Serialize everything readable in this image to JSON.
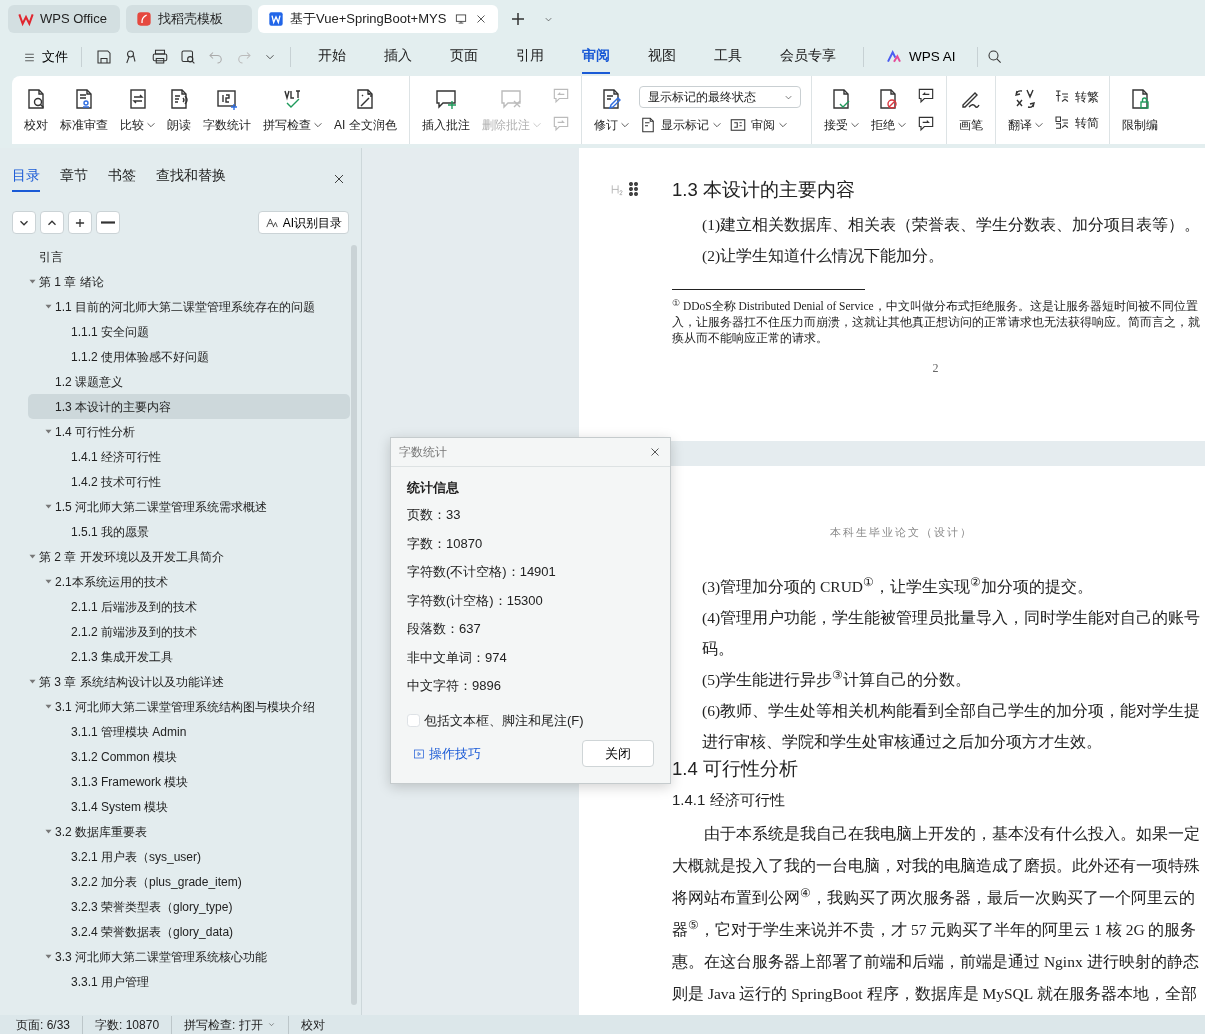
{
  "app_tabs": [
    {
      "label": "WPS Office",
      "selected": false
    },
    {
      "label": "找稻壳模板",
      "selected": false
    },
    {
      "label": "基于Vue+SpringBoot+MYS",
      "selected": true
    }
  ],
  "menu": {
    "file": "文件",
    "tabs": [
      {
        "label": "开始",
        "selected": false
      },
      {
        "label": "插入",
        "selected": false
      },
      {
        "label": "页面",
        "selected": false
      },
      {
        "label": "引用",
        "selected": false
      },
      {
        "label": "审阅",
        "selected": true
      },
      {
        "label": "视图",
        "selected": false
      },
      {
        "label": "工具",
        "selected": false
      },
      {
        "label": "会员专享",
        "selected": false
      }
    ],
    "ai": "WPS AI"
  },
  "ribbon": {
    "groups": [
      {
        "items": [
          {
            "kind": "large",
            "label": "校对",
            "dropdown": false,
            "disabled": false
          },
          {
            "kind": "large",
            "label": "标准审查",
            "dropdown": false,
            "disabled": false
          },
          {
            "kind": "large",
            "label": "比较",
            "dropdown": true,
            "disabled": false
          },
          {
            "kind": "large",
            "label": "朗读",
            "dropdown": false,
            "disabled": false
          },
          {
            "kind": "large",
            "label": "字数统计",
            "dropdown": false,
            "disabled": false
          },
          {
            "kind": "large",
            "label": "拼写检查",
            "dropdown": true,
            "disabled": false
          },
          {
            "kind": "large",
            "label": "AI 全文润色",
            "dropdown": false,
            "disabled": false
          }
        ]
      },
      {
        "items": [
          {
            "kind": "large",
            "label": "插入批注",
            "dropdown": false,
            "disabled": false
          },
          {
            "kind": "large",
            "label": "删除批注",
            "dropdown": true,
            "disabled": true
          },
          {
            "kind": "stack",
            "rows": [
              [
                {
                  "kind": "icon",
                  "disabled": true
                }
              ],
              [
                {
                  "kind": "icon",
                  "disabled": true
                }
              ]
            ]
          }
        ]
      },
      {
        "items": [
          {
            "kind": "large",
            "label": "修订",
            "dropdown": true,
            "disabled": false
          },
          {
            "kind": "stack",
            "rows": [
              [
                {
                  "kind": "select",
                  "value": "显示标记的最终状态"
                }
              ],
              [
                {
                  "kind": "small",
                  "label": "显示标记",
                  "dropdown": true
                },
                {
                  "kind": "small",
                  "label": "审阅",
                  "dropdown": true
                }
              ]
            ]
          }
        ]
      },
      {
        "items": [
          {
            "kind": "large",
            "label": "接受",
            "dropdown": true,
            "disabled": false
          },
          {
            "kind": "large",
            "label": "拒绝",
            "dropdown": true,
            "disabled": false
          },
          {
            "kind": "stack",
            "rows": [
              [
                {
                  "kind": "icon",
                  "disabled": false
                }
              ],
              [
                {
                  "kind": "icon",
                  "disabled": false
                }
              ]
            ]
          }
        ]
      },
      {
        "items": [
          {
            "kind": "large",
            "label": "画笔",
            "dropdown": false,
            "disabled": false
          }
        ]
      },
      {
        "items": [
          {
            "kind": "large",
            "label": "翻译",
            "dropdown": true,
            "disabled": false
          },
          {
            "kind": "stack",
            "rows": [
              [
                {
                  "kind": "small",
                  "label": "转繁",
                  "dropdown": false
                }
              ],
              [
                {
                  "kind": "small",
                  "label": "转简",
                  "dropdown": false
                }
              ]
            ]
          }
        ]
      },
      {
        "items": [
          {
            "kind": "large",
            "label": "限制编",
            "dropdown": false,
            "disabled": false
          }
        ]
      }
    ]
  },
  "sidebar": {
    "tabs": [
      {
        "label": "目录",
        "selected": true
      },
      {
        "label": "章节",
        "selected": false
      },
      {
        "label": "书签",
        "selected": false
      },
      {
        "label": "查找和替换",
        "selected": false
      }
    ],
    "ai_button": "AI识别目录",
    "outline": [
      {
        "label": "引言",
        "selected": false
      },
      {
        "label": "第 1 章  绪论",
        "selected": false,
        "expanded": true,
        "children": [
          {
            "label": "1.1  目前的河北师大第二课堂管理系统存在的问题",
            "selected": false,
            "expanded": true,
            "children": [
              {
                "label": "1.1.1  安全问题",
                "selected": false
              },
              {
                "label": "1.1.2  使用体验感不好问题",
                "selected": false
              }
            ]
          },
          {
            "label": "1.2  课题意义",
            "selected": false
          },
          {
            "label": "1.3  本设计的主要内容",
            "selected": true
          },
          {
            "label": "1.4  可行性分析",
            "selected": false,
            "expanded": true,
            "children": [
              {
                "label": "1.4.1  经济可行性",
                "selected": false
              },
              {
                "label": "1.4.2  技术可行性",
                "selected": false
              }
            ]
          },
          {
            "label": "1.5  河北师大第二课堂管理系统需求概述",
            "selected": false,
            "expanded": true,
            "children": [
              {
                "label": "1.5.1  我的愿景",
                "selected": false
              }
            ]
          }
        ]
      },
      {
        "label": "第 2 章    开发环境以及开发工具简介",
        "selected": false,
        "expanded": true,
        "children": [
          {
            "label": "2.1本系统运用的技术",
            "selected": false,
            "expanded": true,
            "children": [
              {
                "label": "2.1.1  后端涉及到的技术",
                "selected": false
              },
              {
                "label": "2.1.2  前端涉及到的技术",
                "selected": false
              },
              {
                "label": "2.1.3  集成开发工具",
                "selected": false
              }
            ]
          }
        ]
      },
      {
        "label": "第 3 章    系统结构设计以及功能详述",
        "selected": false,
        "expanded": true,
        "children": [
          {
            "label": "3.1  河北师大第二课堂管理系统结构图与模块介绍",
            "selected": false,
            "expanded": true,
            "children": [
              {
                "label": "3.1.1  管理模块 Admin",
                "selected": false
              },
              {
                "label": "3.1.2 Common 模块",
                "selected": false
              },
              {
                "label": "3.1.3 Framework 模块",
                "selected": false
              },
              {
                "label": "3.1.4 System 模块",
                "selected": false
              }
            ]
          },
          {
            "label": "3.2  数据库重要表",
            "selected": false,
            "expanded": true,
            "children": [
              {
                "label": "3.2.1  用户表（sys_user)",
                "selected": false
              },
              {
                "label": "3.2.2  加分表（plus_grade_item)",
                "selected": false
              },
              {
                "label": "3.2.3  荣誉类型表（glory_type)",
                "selected": false
              },
              {
                "label": "3.2.4  荣誉数据表（glory_data)",
                "selected": false
              }
            ]
          },
          {
            "label": "3.3  河北师大第二课堂管理系统核心功能",
            "selected": false,
            "expanded": true,
            "children": [
              {
                "label": "3.3.1  用户管理",
                "selected": false
              }
            ]
          }
        ]
      }
    ]
  },
  "document": {
    "page1": {
      "blocks": [
        {
          "kind": "heading2",
          "text": "1.3  本设计的主要内容"
        },
        {
          "kind": "item",
          "text": "(1)建立相关数据库、相关表（荣誉表、学生分数表、加分项目表等）。"
        },
        {
          "kind": "item",
          "text": "(2)让学生知道什么情况下能加分。"
        }
      ],
      "footnote": [
        "$^{①}$ DDoS全称 Distributed Denial of Service，中文叫做分布式拒绝服务。这是让服务器短时间被不同位置",
        "入，让服务器扛不住压力而崩溃，这就让其他真正想访问的正常请求也无法获得响应。简而言之，就",
        "痪从而不能响应正常的请求。"
      ],
      "page_number": "2"
    },
    "page2": {
      "header": "本科生毕业论文（设计）",
      "blocks": [
        {
          "kind": "item",
          "text": "(3)管理加分项的 CRUD$^{①}$，让学生实现$^{②}$加分项的提交。"
        },
        {
          "kind": "item",
          "text": "(4)管理用户功能，学生能被管理员批量导入，同时学生能对自己的账号"
        },
        {
          "kind": "item",
          "text": "码。"
        },
        {
          "kind": "item",
          "text": "(5)学生能进行异步$^{③}$计算自己的分数。"
        },
        {
          "kind": "item",
          "text": "(6)教师、学生处等相关机构能看到全部自己学生的加分项，能对学生提"
        },
        {
          "kind": "item",
          "text": "进行审核、学院和学生处审核通过之后加分项方才生效。"
        },
        {
          "kind": "heading2",
          "text": "1.4  可行性分析"
        },
        {
          "kind": "heading3",
          "text": "1.4.1  经济可行性"
        },
        {
          "kind": "first",
          "text": "由于本系统是我自己在我电脑上开发的，基本没有什么投入。如果一定"
        },
        {
          "kind": "line",
          "text": "大概就是投入了我的一台电脑，对我的电脑造成了磨损。此外还有一项特殊"
        },
        {
          "kind": "line",
          "text": "将网站布置到公网$^{④}$，我购买了两次服务器，最后一次购买了一个阿里云的"
        },
        {
          "kind": "line",
          "text": "器$^{⑤}$，它对于学生来说并不贵，才 57 元购买了半年的阿里云 1 核 2G 的服务"
        },
        {
          "kind": "line",
          "text": "惠。在这台服务器上部署了前端和后端，前端是通过 Nginx 进行映射的静态"
        },
        {
          "kind": "line",
          "text": "则是 Java 运行的 SpringBoot 程序，数据库是 MySQL 就在服务器本地，全部"
        }
      ]
    }
  },
  "dialog": {
    "title": "字数统计",
    "section": "统计信息",
    "stats": [
      {
        "label": "页数：",
        "value": "33"
      },
      {
        "label": "字数：",
        "value": "10870"
      },
      {
        "label": "字符数(不计空格)：",
        "value": "14901"
      },
      {
        "label": "字符数(计空格)：",
        "value": "15300"
      },
      {
        "label": "段落数：",
        "value": "637"
      },
      {
        "label": "非中文单词：",
        "value": "974"
      },
      {
        "label": "中文字符：",
        "value": "9896"
      }
    ],
    "checkbox": {
      "label": "包括文本框、脚注和尾注(F)",
      "checked": false
    },
    "tips_link": "操作技巧",
    "close_button": "关闭"
  },
  "status_bar": {
    "page": "页面: 6/33",
    "words": "字数: 10870",
    "spell": "拼写检查: 打开",
    "proofread": "校对"
  }
}
